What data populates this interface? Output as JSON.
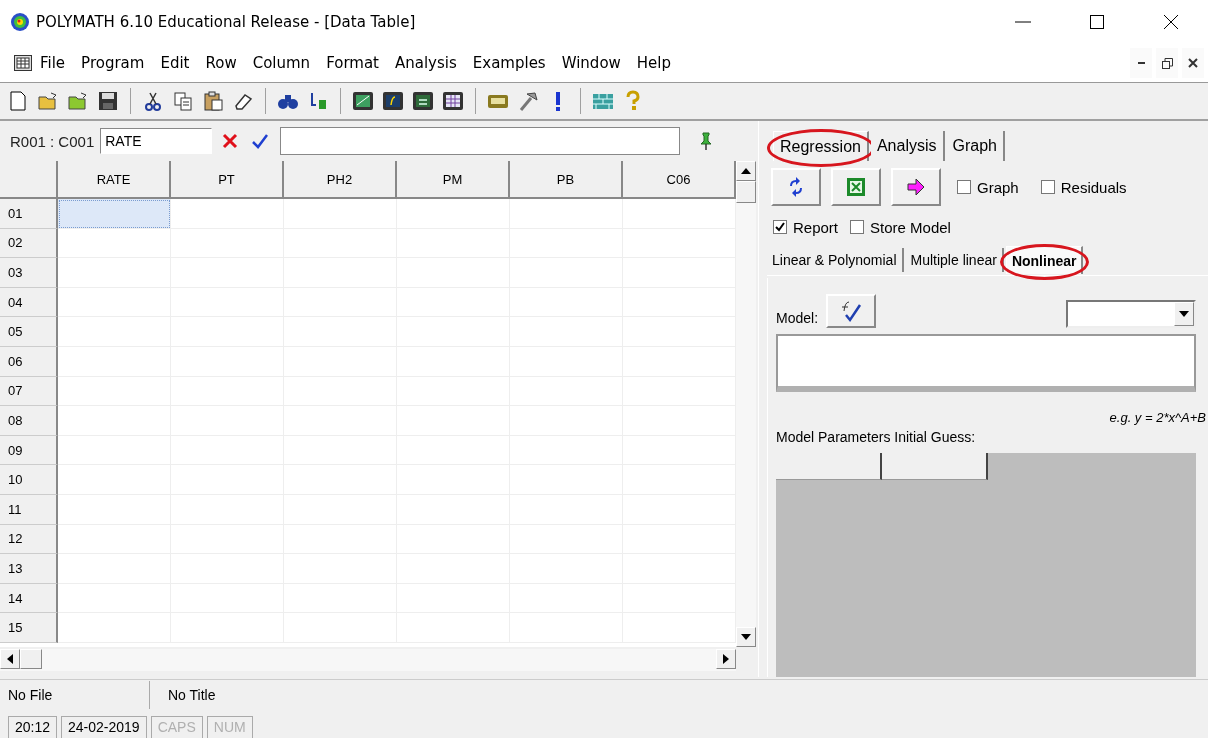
{
  "window": {
    "title": "POLYMATH 6.10 Educational Release - [Data Table]"
  },
  "menu": [
    "File",
    "Program",
    "Edit",
    "Row",
    "Column",
    "Format",
    "Analysis",
    "Examples",
    "Window",
    "Help"
  ],
  "cell_bar": {
    "address": "R001 : C001",
    "name_value": "RATE"
  },
  "table": {
    "columns": [
      "RATE",
      "PT",
      "PH2",
      "PM",
      "PB",
      "C06"
    ],
    "rows": [
      {
        "label": "01",
        "selected_cells": [
          true,
          false,
          false,
          false,
          false,
          false
        ]
      },
      {
        "label": "02",
        "selected_cells": [
          false,
          false,
          false,
          false,
          false,
          false
        ]
      },
      {
        "label": "03",
        "selected_cells": [
          false,
          false,
          false,
          false,
          false,
          false
        ]
      },
      {
        "label": "04",
        "selected_cells": [
          false,
          false,
          false,
          false,
          false,
          false
        ]
      },
      {
        "label": "05",
        "selected_cells": [
          false,
          false,
          false,
          false,
          false,
          false
        ]
      },
      {
        "label": "06",
        "selected_cells": [
          false,
          false,
          false,
          false,
          false,
          false
        ]
      },
      {
        "label": "07",
        "selected_cells": [
          false,
          false,
          false,
          false,
          false,
          false
        ]
      },
      {
        "label": "08",
        "selected_cells": [
          false,
          false,
          false,
          false,
          false,
          false
        ]
      },
      {
        "label": "09",
        "selected_cells": [
          false,
          false,
          false,
          false,
          false,
          false
        ]
      },
      {
        "label": "10",
        "selected_cells": [
          false,
          false,
          false,
          false,
          false,
          false
        ]
      },
      {
        "label": "11",
        "selected_cells": [
          false,
          false,
          false,
          false,
          false,
          false
        ]
      },
      {
        "label": "12",
        "selected_cells": [
          false,
          false,
          false,
          false,
          false,
          false
        ]
      },
      {
        "label": "13",
        "selected_cells": [
          false,
          false,
          false,
          false,
          false,
          false
        ]
      },
      {
        "label": "14",
        "selected_cells": [
          false,
          false,
          false,
          false,
          false,
          false
        ]
      },
      {
        "label": "15",
        "selected_cells": [
          false,
          false,
          false,
          false,
          false,
          false
        ]
      }
    ]
  },
  "panel": {
    "tabs": [
      {
        "label": "Regression",
        "selected": true,
        "circled": true
      },
      {
        "label": "Analysis",
        "selected": false,
        "circled": false
      },
      {
        "label": "Graph",
        "selected": false,
        "circled": false
      }
    ],
    "options": [
      {
        "label": "Graph",
        "checked": false
      },
      {
        "label": "Residuals",
        "checked": false
      },
      {
        "label": "Report",
        "checked": true
      },
      {
        "label": "Store Model",
        "checked": false
      }
    ],
    "subtabs": [
      {
        "label": "Linear & Polynomial",
        "selected": false,
        "circled": false
      },
      {
        "label": "Multiple linear",
        "selected": false,
        "circled": false
      },
      {
        "label": "Nonlinear",
        "selected": true,
        "circled": true
      }
    ],
    "model_label": "Model:",
    "example": "e.g.  y = 2*x^A+B",
    "params_label": "Model Parameters Initial Guess:"
  },
  "status_bar": {
    "file": "No File",
    "title": "No Title",
    "fields": [
      {
        "text": "20:12",
        "disabled": false
      },
      {
        "text": "24-02-2019",
        "disabled": false
      },
      {
        "text": "CAPS",
        "disabled": true
      },
      {
        "text": "NUM",
        "disabled": true
      }
    ]
  }
}
